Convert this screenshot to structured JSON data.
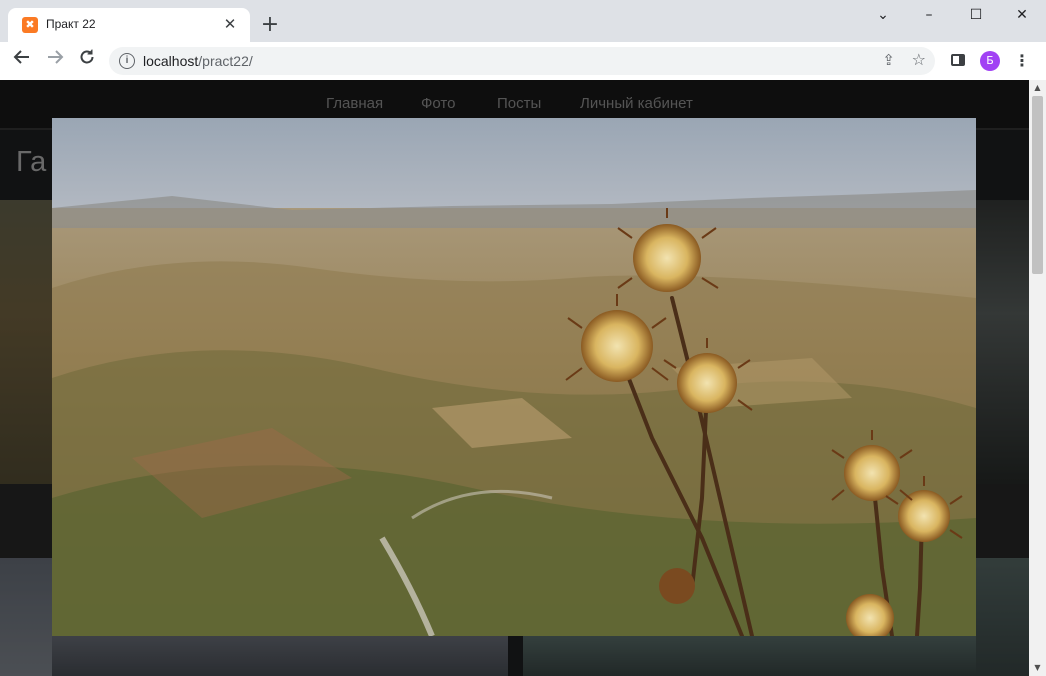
{
  "browser": {
    "tab": {
      "title": "Практ 22",
      "favicon": "xampp-icon",
      "close_label": "✕"
    },
    "new_tab_label": "+",
    "window_controls": {
      "chevron": "⌄",
      "minimize": "–",
      "maximize": "☐",
      "close": "✕"
    },
    "address": {
      "host": "localhost",
      "path": "/pract22/"
    },
    "profile_initial": "Б",
    "icons": [
      "back-arrow-icon",
      "forward-arrow-icon",
      "reload-icon",
      "info-icon",
      "share-icon",
      "star-icon",
      "side-panel-icon",
      "kebab-menu-icon"
    ],
    "profile_color": "#a142f4"
  },
  "site": {
    "nav": [
      "Главная",
      "Фото",
      "Посты",
      "Личный кабинет"
    ],
    "page_title_visible": "Га"
  },
  "lightbox": {
    "image_subject": "thistle-flowers-over-valley-landscape"
  }
}
